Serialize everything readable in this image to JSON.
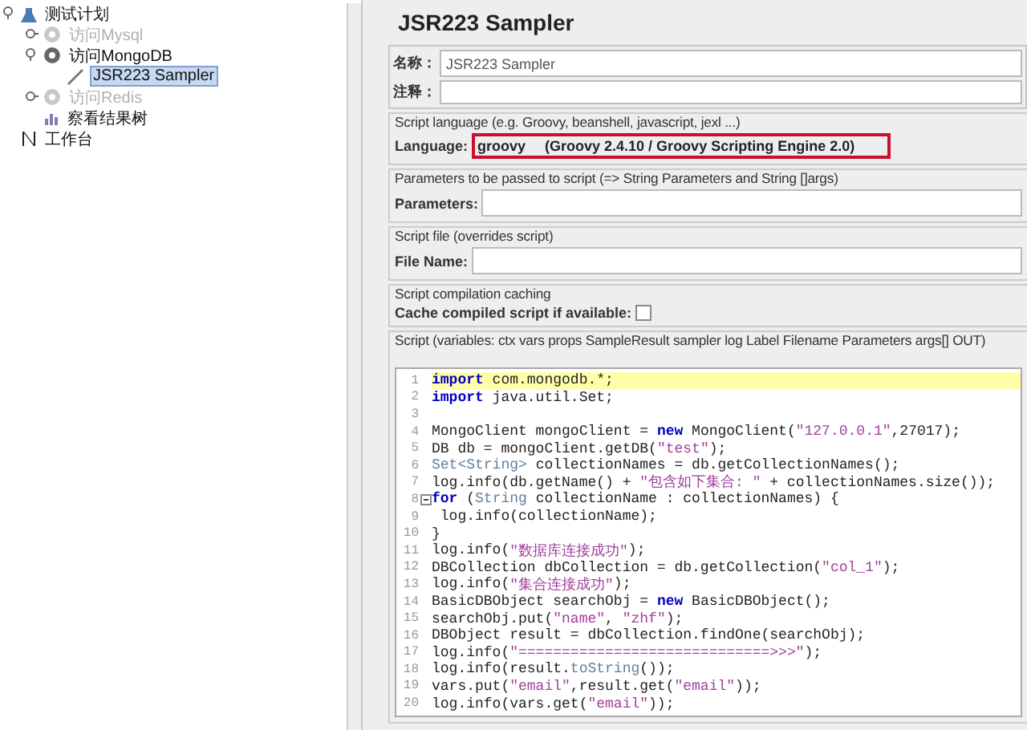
{
  "tree": [
    {
      "label": "测试计划",
      "kind": "plan",
      "disabled": false,
      "expanded": true,
      "selected": false,
      "children": [
        {
          "label": "访问Mysql",
          "kind": "group",
          "disabled": true,
          "expanded": false,
          "selected": false
        },
        {
          "label": "访问MongoDB",
          "kind": "group",
          "disabled": false,
          "expanded": true,
          "selected": false,
          "children": [
            {
              "label": "JSR223 Sampler",
              "kind": "sampler",
              "disabled": false,
              "selected": true
            }
          ]
        },
        {
          "label": "访问Redis",
          "kind": "group",
          "disabled": true,
          "expanded": false,
          "selected": false
        },
        {
          "label": "察看结果树",
          "kind": "listener",
          "disabled": false,
          "selected": false
        }
      ]
    },
    {
      "label": "工作台",
      "kind": "workbench",
      "disabled": false,
      "selected": false
    }
  ],
  "panel": {
    "title": "JSR223 Sampler",
    "name": {
      "label": "名称：",
      "value": "JSR223 Sampler"
    },
    "comment": {
      "label": "注释："
    },
    "language": {
      "legend": "Script language (e.g. Groovy, beanshell, javascript, jexl ...)",
      "label": "Language:",
      "value": "groovy",
      "engine": "(Groovy 2.4.10 / Groovy Scripting Engine 2.0)",
      "highlighted": true
    },
    "parameters": {
      "legend": "Parameters to be passed to script (=> String Parameters and String []args)",
      "label": "Parameters:"
    },
    "file": {
      "legend": "Script file (overrides script)",
      "label": "File Name:"
    },
    "caching": {
      "legend": "Script compilation caching",
      "label": "Cache compiled script if available:",
      "checked": false
    },
    "script": {
      "legend": "Script (variables: ctx vars props SampleResult sampler log Label Filename Parameters args[] OUT)",
      "lines": [
        {
          "number": "1",
          "current": true,
          "fold": false,
          "tokens": [
            {
              "kind": "keyword",
              "text": "import"
            },
            {
              "kind": "plain",
              "text": " com.mongodb.*;"
            }
          ]
        },
        {
          "number": "2",
          "current": false,
          "fold": false,
          "tokens": [
            {
              "kind": "keyword",
              "text": "import"
            },
            {
              "kind": "plain",
              "text": " java.util.Set;"
            }
          ]
        },
        {
          "number": "3",
          "current": false,
          "fold": false
        },
        {
          "number": "4",
          "current": false,
          "fold": false,
          "tokens": [
            {
              "kind": "plain",
              "text": "MongoClient mongoClient = "
            },
            {
              "kind": "keyword",
              "text": "new"
            },
            {
              "kind": "plain",
              "text": " MongoClient("
            },
            {
              "kind": "string",
              "text": "\"127.0.0.1\""
            },
            {
              "kind": "plain",
              "text": ",27017);"
            }
          ]
        },
        {
          "number": "5",
          "current": false,
          "fold": false,
          "tokens": [
            {
              "kind": "plain",
              "text": "DB db = mongoClient.getDB("
            },
            {
              "kind": "string",
              "text": "\"test\""
            },
            {
              "kind": "plain",
              "text": ");"
            }
          ]
        },
        {
          "number": "6",
          "current": false,
          "fold": false,
          "tokens": [
            {
              "kind": "type",
              "text": "Set<String>"
            },
            {
              "kind": "plain",
              "text": " collectionNames = db.getCollectionNames();"
            }
          ]
        },
        {
          "number": "7",
          "current": false,
          "fold": false,
          "tokens": [
            {
              "kind": "plain",
              "text": "log.info(db.getName() + "
            },
            {
              "kind": "string",
              "text": "\"包含如下集合: \""
            },
            {
              "kind": "plain",
              "text": " + collectionNames.size());"
            }
          ]
        },
        {
          "number": "8",
          "current": false,
          "fold": true,
          "tokens": [
            {
              "kind": "keyword",
              "text": "for"
            },
            {
              "kind": "plain",
              "text": " ("
            },
            {
              "kind": "type",
              "text": "String"
            },
            {
              "kind": "plain",
              "text": " collectionName : collectionNames) {"
            }
          ]
        },
        {
          "number": "9",
          "current": false,
          "fold": false,
          "tokens": [
            {
              "kind": "plain",
              "text": " log.info(collectionName);"
            }
          ]
        },
        {
          "number": "10",
          "current": false,
          "fold": false,
          "tokens": [
            {
              "kind": "plain",
              "text": "}"
            }
          ]
        },
        {
          "number": "11",
          "current": false,
          "fold": false,
          "tokens": [
            {
              "kind": "plain",
              "text": "log.info("
            },
            {
              "kind": "string",
              "text": "\"数据库连接成功\""
            },
            {
              "kind": "plain",
              "text": ");"
            }
          ]
        },
        {
          "number": "12",
          "current": false,
          "fold": false,
          "tokens": [
            {
              "kind": "plain",
              "text": "DBCollection dbCollection = db.getCollection("
            },
            {
              "kind": "string",
              "text": "\"col_1\""
            },
            {
              "kind": "plain",
              "text": ");"
            }
          ]
        },
        {
          "number": "13",
          "current": false,
          "fold": false,
          "tokens": [
            {
              "kind": "plain",
              "text": "log.info("
            },
            {
              "kind": "string",
              "text": "\"集合连接成功\""
            },
            {
              "kind": "plain",
              "text": ");"
            }
          ]
        },
        {
          "number": "14",
          "current": false,
          "fold": false,
          "tokens": [
            {
              "kind": "plain",
              "text": "BasicDBObject searchObj = "
            },
            {
              "kind": "keyword",
              "text": "new"
            },
            {
              "kind": "plain",
              "text": " BasicDBObject();"
            }
          ]
        },
        {
          "number": "15",
          "current": false,
          "fold": false,
          "tokens": [
            {
              "kind": "plain",
              "text": "searchObj.put("
            },
            {
              "kind": "string",
              "text": "\"name\""
            },
            {
              "kind": "plain",
              "text": ", "
            },
            {
              "kind": "string",
              "text": "\"zhf\""
            },
            {
              "kind": "plain",
              "text": ");"
            }
          ]
        },
        {
          "number": "16",
          "current": false,
          "fold": false,
          "tokens": [
            {
              "kind": "plain",
              "text": "DBObject result = dbCollection.findOne(searchObj);"
            }
          ]
        },
        {
          "number": "17",
          "current": false,
          "fold": false,
          "tokens": [
            {
              "kind": "plain",
              "text": "log.info("
            },
            {
              "kind": "string",
              "text": "\"=============================>>>\""
            },
            {
              "kind": "plain",
              "text": ");"
            }
          ]
        },
        {
          "number": "18",
          "current": false,
          "fold": false,
          "tokens": [
            {
              "kind": "plain",
              "text": "log.info(result."
            },
            {
              "kind": "type",
              "text": "toString"
            },
            {
              "kind": "plain",
              "text": "());"
            }
          ]
        },
        {
          "number": "19",
          "current": false,
          "fold": false,
          "tokens": [
            {
              "kind": "plain",
              "text": "vars.put("
            },
            {
              "kind": "string",
              "text": "\"email\""
            },
            {
              "kind": "plain",
              "text": ",result.get("
            },
            {
              "kind": "string",
              "text": "\"email\""
            },
            {
              "kind": "plain",
              "text": "));"
            }
          ]
        },
        {
          "number": "20",
          "current": false,
          "fold": false,
          "tokens": [
            {
              "kind": "plain",
              "text": "log.info(vars.get("
            },
            {
              "kind": "string",
              "text": "\"email\""
            },
            {
              "kind": "plain",
              "text": "));"
            }
          ]
        }
      ]
    }
  }
}
